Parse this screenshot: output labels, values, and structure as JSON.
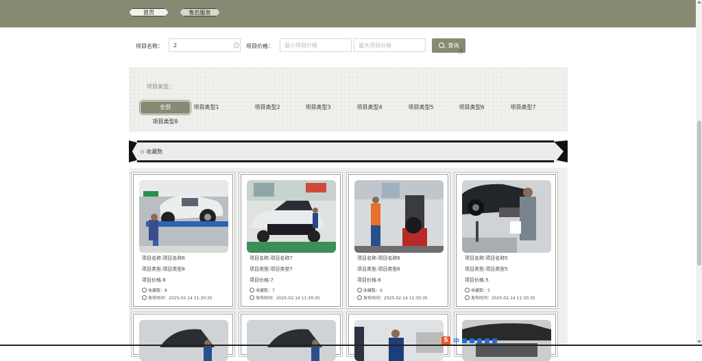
{
  "nav": {
    "home_label": "首页",
    "after_sales_label": "售后服务"
  },
  "search": {
    "name_label": "项目名称：",
    "name_value": "2",
    "price_label": "项目价格：",
    "min_price_placeholder": "最小项目价格",
    "max_price_placeholder": "最大项目价格",
    "button_label": "查询"
  },
  "filter": {
    "title": "项目类型：",
    "types": [
      "全部",
      "项目类型1",
      "项目类型2",
      "项目类型3",
      "项目类型4",
      "项目类型5",
      "项目类型6",
      "项目类型7",
      "项目类型8"
    ],
    "selected": "全部"
  },
  "favorite_section": {
    "label": "✩ 收藏数"
  },
  "cards": [
    {
      "name": "项目名称:项目名称8",
      "type": "项目类型:项目类型8",
      "price": "项目价格:8",
      "favorites": "收藏数：8",
      "published": "发布时间：2025-02-14 11:30:35"
    },
    {
      "name": "项目名称:项目名称7",
      "type": "项目类型:项目类型7",
      "price": "项目价格:7",
      "favorites": "收藏数：7",
      "published": "发布时间：2025-02-14 11:30:35"
    },
    {
      "name": "项目名称:项目名称6",
      "type": "项目类型:项目类型6",
      "price": "项目价格:6",
      "favorites": "收藏数：6",
      "published": "发布时间：2025-02-14 11:30:35"
    },
    {
      "name": "项目名称:项目名称5",
      "type": "项目类型:项目类型5",
      "price": "项目价格:5",
      "favorites": "收藏数：5",
      "published": "发布时间：2025-02-14 11:30:35"
    }
  ],
  "ime": {
    "lang": "中"
  },
  "colors": {
    "accent": "#868b73",
    "panel": "#efefec"
  }
}
